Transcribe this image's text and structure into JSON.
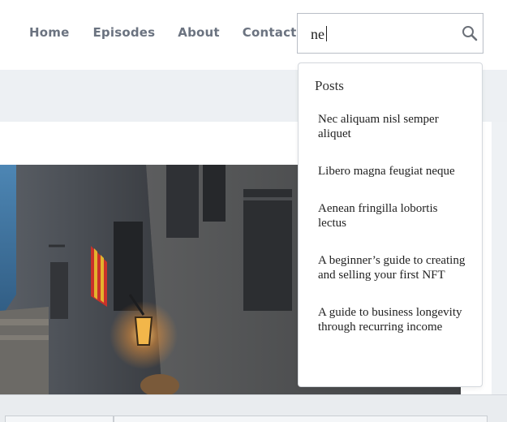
{
  "nav": {
    "items": [
      {
        "label": "Home"
      },
      {
        "label": "Episodes"
      },
      {
        "label": "About"
      },
      {
        "label": "Contact"
      }
    ]
  },
  "search": {
    "value": "ne",
    "icon": "search-icon"
  },
  "dropdown": {
    "heading": "Posts",
    "items": [
      {
        "title": "Nec aliquam nisl semper aliquet"
      },
      {
        "title": "Libero magna feugiat neque"
      },
      {
        "title": "Aenean fringilla lobortis lectus"
      },
      {
        "title": "A beginner’s guide to creating and selling your first NFT"
      },
      {
        "title": "A guide to business longevity through recurring income"
      }
    ]
  },
  "colors": {
    "nav_text": "#6b7380",
    "page_bg": "#eef1f4",
    "border": "#b9bec6"
  }
}
